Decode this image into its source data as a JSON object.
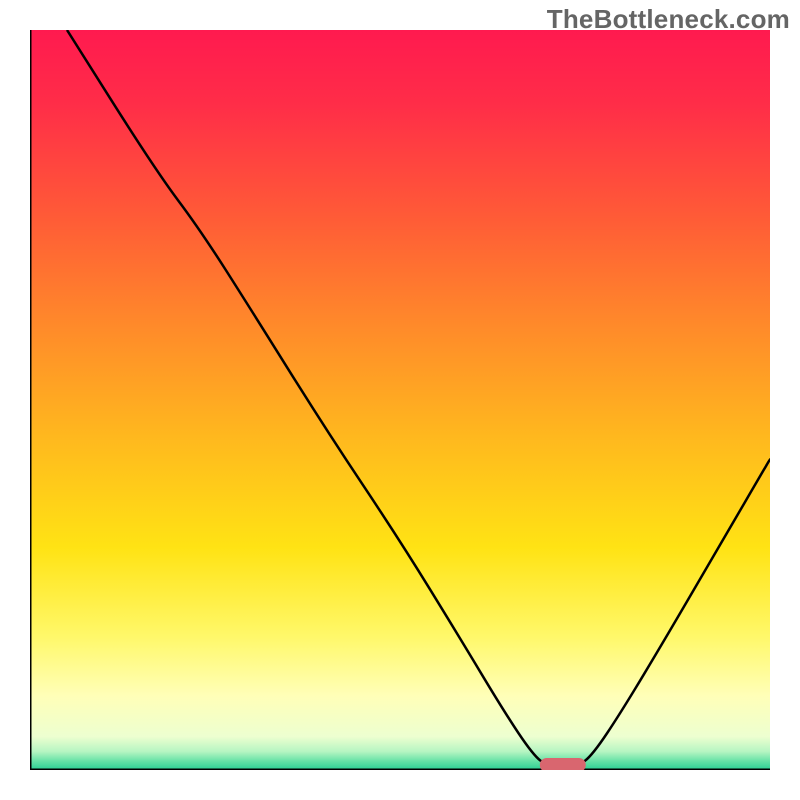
{
  "watermark": "TheBottleneck.com",
  "chart_data": {
    "type": "line",
    "title": "",
    "xlabel": "",
    "ylabel": "",
    "xlim": [
      0,
      100
    ],
    "ylim": [
      0,
      100
    ],
    "grid": false,
    "legend": false,
    "marker": {
      "x": 72,
      "y": 0,
      "color": "#d9666f",
      "shape": "pill"
    },
    "gradient_stops": [
      {
        "offset": 0.0,
        "color": "#ff1a4f"
      },
      {
        "offset": 0.1,
        "color": "#ff2d48"
      },
      {
        "offset": 0.25,
        "color": "#ff5a37"
      },
      {
        "offset": 0.4,
        "color": "#ff8a2a"
      },
      {
        "offset": 0.55,
        "color": "#ffb81e"
      },
      {
        "offset": 0.7,
        "color": "#ffe314"
      },
      {
        "offset": 0.82,
        "color": "#fff86a"
      },
      {
        "offset": 0.9,
        "color": "#ffffb8"
      },
      {
        "offset": 0.955,
        "color": "#edffd0"
      },
      {
        "offset": 0.975,
        "color": "#b6f5c2"
      },
      {
        "offset": 0.988,
        "color": "#66e2a6"
      },
      {
        "offset": 1.0,
        "color": "#28cf93"
      }
    ],
    "series": [
      {
        "name": "curve",
        "points": [
          {
            "x": 5,
            "y": 100
          },
          {
            "x": 17,
            "y": 81
          },
          {
            "x": 23,
            "y": 73
          },
          {
            "x": 30,
            "y": 62
          },
          {
            "x": 40,
            "y": 46
          },
          {
            "x": 50,
            "y": 31
          },
          {
            "x": 58,
            "y": 18
          },
          {
            "x": 64,
            "y": 8
          },
          {
            "x": 68,
            "y": 2
          },
          {
            "x": 70,
            "y": 0.5
          },
          {
            "x": 74,
            "y": 0.5
          },
          {
            "x": 76,
            "y": 2
          },
          {
            "x": 80,
            "y": 8
          },
          {
            "x": 86,
            "y": 18
          },
          {
            "x": 93,
            "y": 30
          },
          {
            "x": 100,
            "y": 42
          }
        ]
      }
    ]
  }
}
